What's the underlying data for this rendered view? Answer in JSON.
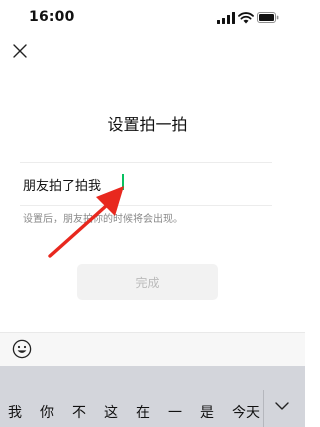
{
  "status_bar": {
    "time": "16:00"
  },
  "dialog": {
    "title": "设置拍一拍",
    "prefix": "朋友拍了拍我",
    "input_value": "",
    "hint": "设置后，朋友拍你的时候将会出现。",
    "done_label": "完成"
  },
  "keyboard": {
    "candidates": [
      "我",
      "你",
      "不",
      "这",
      "在",
      "一",
      "是",
      "今天"
    ]
  },
  "colors": {
    "accent": "#07c160",
    "arrow": "#e8281e"
  },
  "icons": [
    "close-icon",
    "signal-icon",
    "wifi-icon",
    "battery-icon",
    "emoji-icon",
    "chevron-down-icon"
  ]
}
